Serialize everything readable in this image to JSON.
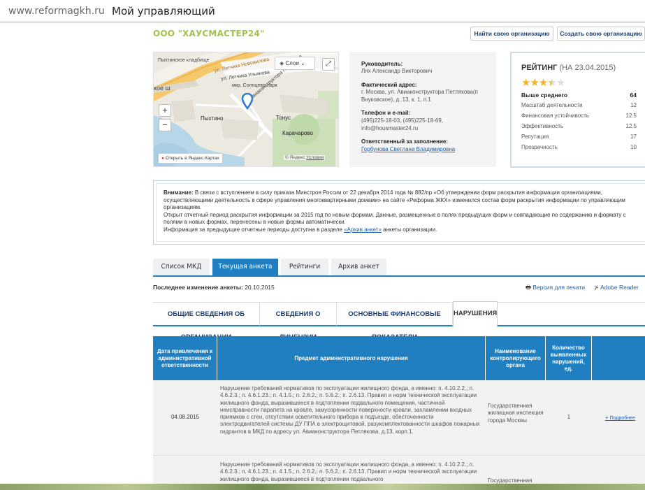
{
  "window": {
    "url": "www.reformagkh.ru",
    "title": "Мой управляющий"
  },
  "org": {
    "name": "ООО \"ХАУСМАСТЕР24\""
  },
  "header_buttons": {
    "find": "Найти свою организацию",
    "create": "Создать свою организацию"
  },
  "map": {
    "layers_label": "Слои",
    "open_label": "Открыть в Яндекс.Картах",
    "copyright": "© Яндекс",
    "terms": "Условия",
    "labels": {
      "cemetery": "Пыхтинское кладбище",
      "street1": "ул. Летчика Новожилова",
      "street2": "ул. Летчика Ульянова",
      "district": "мкр. Солнцево-парк",
      "street3": "ул. Авиаконструктора Петлякова",
      "pykhtino": "Пыхтино",
      "tonus": "Тонус",
      "karacharovo": "Карачарово",
      "highway": "кое ш"
    }
  },
  "info": {
    "director_label": "Руководитель:",
    "director": "Лях Александр Викторович",
    "address_label": "Фактический адрес:",
    "address": "г. Москва, ул. Авиаконструктора Петлякова(п Внуковское), д. 13, к. 1, п.1",
    "phone_label": "Телефон и e-mail:",
    "phone": "(495)225-18-03, (495)225-18-69, info@housmaster24.ru",
    "responsible_label": "Ответственный за заполнение:",
    "responsible": "Горбунова Светлана Владимировна"
  },
  "rating": {
    "title": "РЕЙТИНГ",
    "date": "(НА 23.04.2015)",
    "stars": 3.5,
    "overall_label": "Выше среднего",
    "overall_value": "64",
    "rows": [
      {
        "label": "Масштаб деятельности",
        "value": "12"
      },
      {
        "label": "Финансовая устойчивость",
        "value": "12.5"
      },
      {
        "label": "Эффективность",
        "value": "12.5"
      },
      {
        "label": "Репутация",
        "value": "17"
      },
      {
        "label": "Прозрачность",
        "value": "10"
      }
    ]
  },
  "notice": {
    "bold": "Внимание:",
    "text1": " В связи с вступлением в силу приказа Минстроя России от 22 декабря 2014 года № 882/пр «Об утверждении форм раскрытия информации организациями, осуществляющими деятельность в сфере управления многоквартирными домами» на сайте «Реформа ЖКХ» изменился состав форм раскрытия информации по управляющим организациям.",
    "text2": "Открыт отчетный период раскрытия информации за 2015 год по новым формам. Данные, размещенные в полях предыдущих форм и совпадающие по содержанию и формату с полями в новых формах, перенесены в новые формы автоматически.",
    "text3": "Информация за предыдущие отчетные периоды доступна в разделе ",
    "archive_link": "«Архив анкет»",
    "text4": " анкеты организации."
  },
  "tabs": [
    "Список МКД",
    "Текущая анкета",
    "Рейтинги",
    "Архив анкет"
  ],
  "lastmod": {
    "label": "Последнее изменение анкеты:",
    "date": "20.10.2015"
  },
  "print_link": "Версия для печати",
  "reader_link": "Adobe Reader",
  "subtabs": [
    "ОБЩИЕ СВЕДЕНИЯ ОБ ОРГАНИЗАЦИИ",
    "СВЕДЕНИЯ О ЛИЦЕНЗИИ",
    "ОСНОВНЫЕ ФИНАНСОВЫЕ ПОКАЗАТЕЛИ",
    "НАРУШЕНИЯ"
  ],
  "table": {
    "headers": [
      "Дата привлечения к административной ответственности",
      "Предмет административного нарушения",
      "Наименование контролирующего органа",
      "Количество выявленных нарушений, ед."
    ],
    "rows": [
      {
        "date": "04.08.2015",
        "subject": "Нарушение требований нормативов по эксплуатации жилищного фонда, а именно: п. 4.10.2.2.; п. 4.6.2.3.; п. 4.6.1.23.; п. 4.1.5.; п. 2.6.2.; п. 5.6.2.; п. 2.6.13. Правил и норм технической эксплуатации жилищного фонда, выразившееся в подтоплении подвального помещения, частичной неисправности парапета на кровле, замусоренности поверхности кровли, захламлении входных приямков с стен, отсутствии осветительного прибора в подъезде, обесточенности электродвигателей системы ДУ ППА в электрощитовой, разукомплектованности шкафов пожарных гидрантов в МКД по адресу ул. Авиаконструктора Петлякова, д.13, корп.1.",
        "authority": "Государственная жилищная инспекция города Москвы",
        "count": "1",
        "more": "Подробнее"
      },
      {
        "subject": "Нарушение требований нормативов по эксплуатации жилищного фонда, а именно: п. 4.10.2.2.; п. 4.6.2.3.; п. 4.6.1.23.; п. 4.1.5.; п. 2.6.2.; п. 5.6.2.; п. 2.6.13. Правил и норм технической эксплуатации жилищного фонда, выразившееся в подтоплении подвального",
        "authority": "Государственная"
      }
    ]
  }
}
